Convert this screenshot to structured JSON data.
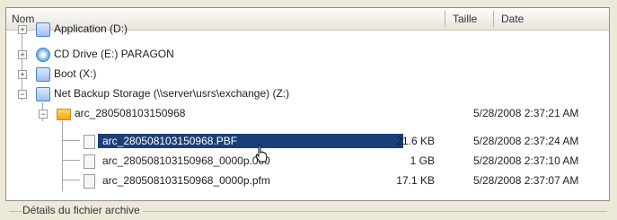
{
  "header": {
    "name_col": "Nom",
    "size_col": "Taille",
    "date_col": "Date"
  },
  "tree": [
    {
      "label": "Application (D:)",
      "size": "",
      "date": "",
      "icon": "drive-icon"
    },
    {
      "label": "CD Drive (E:) PARAGON",
      "size": "",
      "date": "",
      "icon": "cd-drive-icon"
    },
    {
      "label": "Boot (X:)",
      "size": "",
      "date": "",
      "icon": "drive-icon"
    },
    {
      "label": "Net Backup Storage (\\\\server\\usrs\\exchange) (Z:)",
      "size": "",
      "date": "",
      "icon": "network-drive-icon"
    },
    {
      "label": "arc_280508103150968",
      "size": "",
      "date": "5/28/2008 2:37:21 AM",
      "icon": "folder-icon"
    },
    {
      "label": "arc_280508103150968.PBF",
      "size": "21.6 KB",
      "date": "5/28/2008 2:37:24 AM",
      "icon": "file-icon",
      "selected": true
    },
    {
      "label": "arc_280508103150968_0000p.000",
      "size": "1 GB",
      "date": "5/28/2008 2:37:10 AM",
      "icon": "file-icon"
    },
    {
      "label": "arc_280508103150968_0000p.pfm",
      "size": "17.1 KB",
      "date": "5/28/2008 2:37:07 AM",
      "icon": "file-icon"
    }
  ],
  "footer": {
    "details_label": "Détails du fichier archive"
  },
  "colors": {
    "selection": "#1a3f78",
    "panel_bg": "#ffffff",
    "window_bg": "#ece9d8"
  }
}
